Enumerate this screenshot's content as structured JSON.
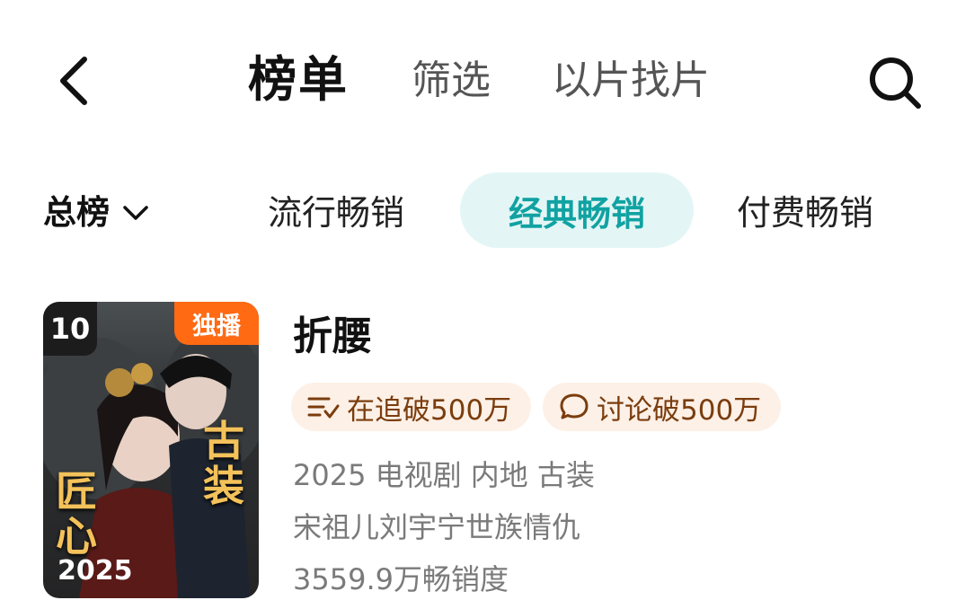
{
  "header": {
    "title": "榜单",
    "tabs": [
      "筛选",
      "以片找片"
    ],
    "back_icon": "chevron-left-icon",
    "search_icon": "search-icon"
  },
  "categories": {
    "main": "总榜",
    "tabs": [
      "流行畅销",
      "经典畅销",
      "付费畅销"
    ],
    "active": "经典畅销",
    "accent_color": "#11a2a2"
  },
  "item": {
    "rank": "10",
    "badge": "独播",
    "title": "折腰",
    "poster_text": {
      "year": "2025",
      "tag1": "古装",
      "tag2": "匠心"
    },
    "pills": [
      {
        "icon": "follow-list-icon",
        "text": "在追破500万"
      },
      {
        "icon": "comment-icon",
        "text": "讨论破500万"
      }
    ],
    "info_line": "2025 电视剧 内地 古装",
    "desc_line": "宋祖儿刘宇宁世族情仇",
    "score_line": "3559.9万畅销度"
  }
}
